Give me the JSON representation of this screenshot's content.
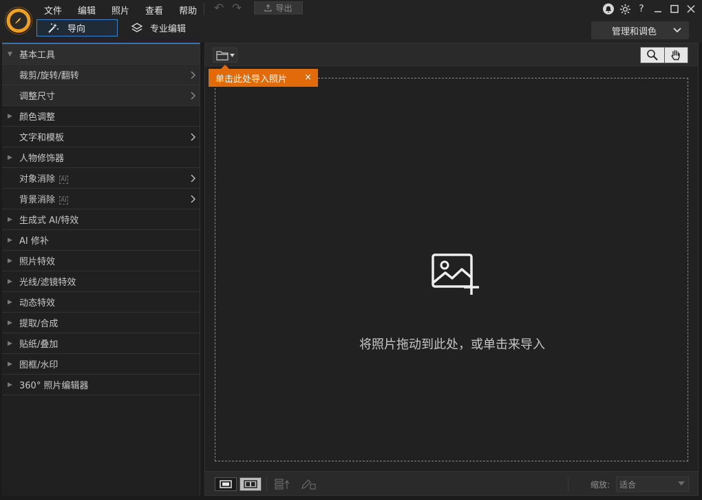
{
  "menu": {
    "items": [
      "文件",
      "编辑",
      "照片",
      "查看",
      "帮助"
    ],
    "export_label": "导出"
  },
  "modes": {
    "guide_label": "导向",
    "pro_label": "专业编辑",
    "manage_label": "管理和调色"
  },
  "left_panel": {
    "sections": [
      {
        "label": "基本工具",
        "kind": "header-open"
      },
      {
        "label": "裁剪/旋转/翻转",
        "kind": "sub"
      },
      {
        "label": "调整尺寸",
        "kind": "sub"
      },
      {
        "label": "颜色调整",
        "kind": "collapsed"
      },
      {
        "label": "文字和模板",
        "kind": "leaf"
      },
      {
        "label": "人物修饰器",
        "kind": "collapsed"
      },
      {
        "label": "对象消除",
        "kind": "leaf-ai"
      },
      {
        "label": "背景消除",
        "kind": "leaf-ai"
      },
      {
        "label": "生成式 AI/特效",
        "kind": "collapsed"
      },
      {
        "label": "AI 修补",
        "kind": "collapsed"
      },
      {
        "label": "照片特效",
        "kind": "collapsed"
      },
      {
        "label": "光线/滤镜特效",
        "kind": "collapsed"
      },
      {
        "label": "动态特效",
        "kind": "collapsed"
      },
      {
        "label": "提取/合成",
        "kind": "collapsed"
      },
      {
        "label": "贴纸/叠加",
        "kind": "collapsed"
      },
      {
        "label": "图框/水印",
        "kind": "collapsed"
      },
      {
        "label": "360° 照片编辑器",
        "kind": "collapsed"
      }
    ]
  },
  "main": {
    "tip_text": "单击此处导入照片",
    "drop_text": "将照片拖动到此处，或单击来导入",
    "zoom_label": "缩放:",
    "zoom_value": "适合"
  },
  "colors": {
    "accent": "#3f86c8",
    "tip": "#e26a08",
    "logo": "#f0a020"
  },
  "icons": {
    "logo": "app-logo-icon",
    "guide": "magic-wand-icon",
    "pro": "layers-icon",
    "folder": "folder-icon",
    "zoom": "magnifier-icon",
    "pan": "hand-icon",
    "add_photo": "image-add-icon"
  }
}
